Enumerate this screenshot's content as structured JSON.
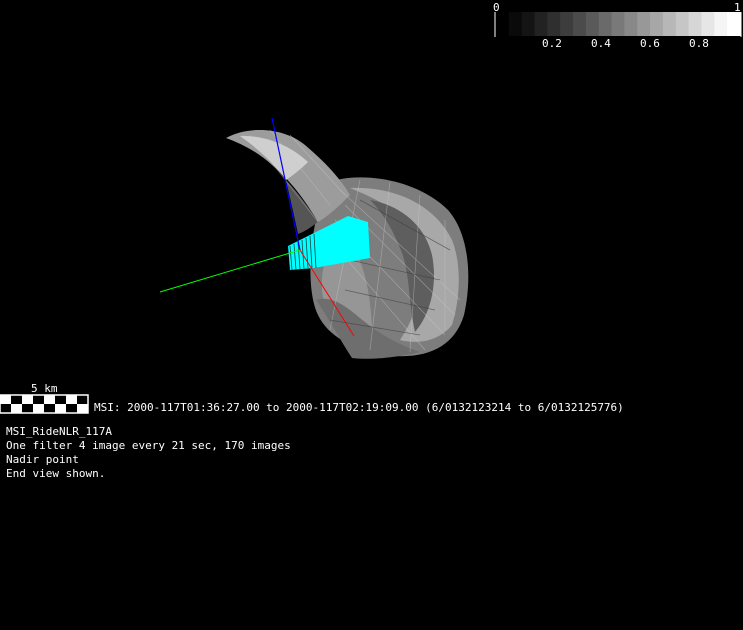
{
  "colorbar": {
    "min_label": "0",
    "max_label": "1",
    "tick_labels": [
      "0.2",
      "0.4",
      "0.6",
      "0.8"
    ],
    "gray_levels": [
      "#000000",
      "#0a0a0a",
      "#141414",
      "#222222",
      "#2f2f2f",
      "#3d3d3d",
      "#4b4b4b",
      "#5a5a5a",
      "#6a6a6a",
      "#797979",
      "#888888",
      "#989898",
      "#a7a7a7",
      "#b7b7b7",
      "#c6c6c6",
      "#d6d6d6",
      "#e6e6e6",
      "#f5f5f5",
      "#ffffff"
    ]
  },
  "scale": {
    "label": "5 km"
  },
  "msi": {
    "line": "MSI:  2000-117T01:36:27.00 to 2000-117T02:19:09.00 (6/0132123214 to 6/0132125776)"
  },
  "info": {
    "name": "MSI_RideNLR_117A",
    "filter": "One filter 4 image every 21 sec, 170 images",
    "pointing": "Nadir point",
    "view": "End view shown."
  },
  "scene": {
    "background": "#000000",
    "asteroid_color": "#8a8a8a",
    "footprint_color": "#00ffff",
    "axis_x_color": "#ff0000",
    "axis_y_color": "#00ff00",
    "axis_z_color": "#0000ff"
  }
}
